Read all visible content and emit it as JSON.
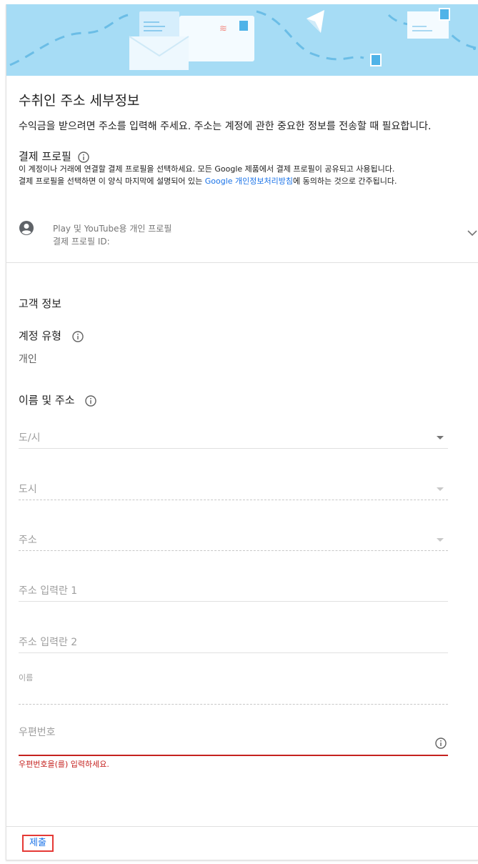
{
  "form": {
    "title": "수취인 주소 세부정보",
    "subtitle": "수익금을 받으려면 주소를 입력해 주세요. 주소는 계정에 관한 중요한 정보를 전송할 때 필요합니다."
  },
  "payment_profile": {
    "heading": "결제 프로필",
    "desc_line1": "이 계정이나 거래에 연결할 결제 프로필을 선택하세요. 모든 Google 제품에서 결제 프로필이 공유되고 사용됩니다.",
    "desc_line2_prefix": "결제 프로필을 선택하면 이 양식 마지막에 설명되어 있는 ",
    "desc_link": "Google 개인정보처리방침",
    "desc_line2_suffix": "에 동의하는 것으로 간주됩니다.",
    "profile_name": "Play 및 YouTube용 개인 프로필",
    "profile_id_label": "결제 프로필 ID:"
  },
  "customer": {
    "heading": "고객 정보",
    "account_type_label": "계정 유형",
    "account_type_value": "개인",
    "name_address_label": "이름 및 주소"
  },
  "fields": {
    "province": "도/시",
    "city": "도시",
    "address": "주소",
    "address_line1": "주소 입력란 1",
    "address_line2": "주소 입력란 2",
    "name": "이름",
    "postal_code": "우편번호",
    "postal_code_error": "우편번호을(를) 입력하세요."
  },
  "actions": {
    "submit": "제출"
  },
  "colors": {
    "banner_bg": "#a6dcf5",
    "link": "#1a73e8",
    "error": "#c5221f",
    "submit_highlight": "#e53935"
  }
}
